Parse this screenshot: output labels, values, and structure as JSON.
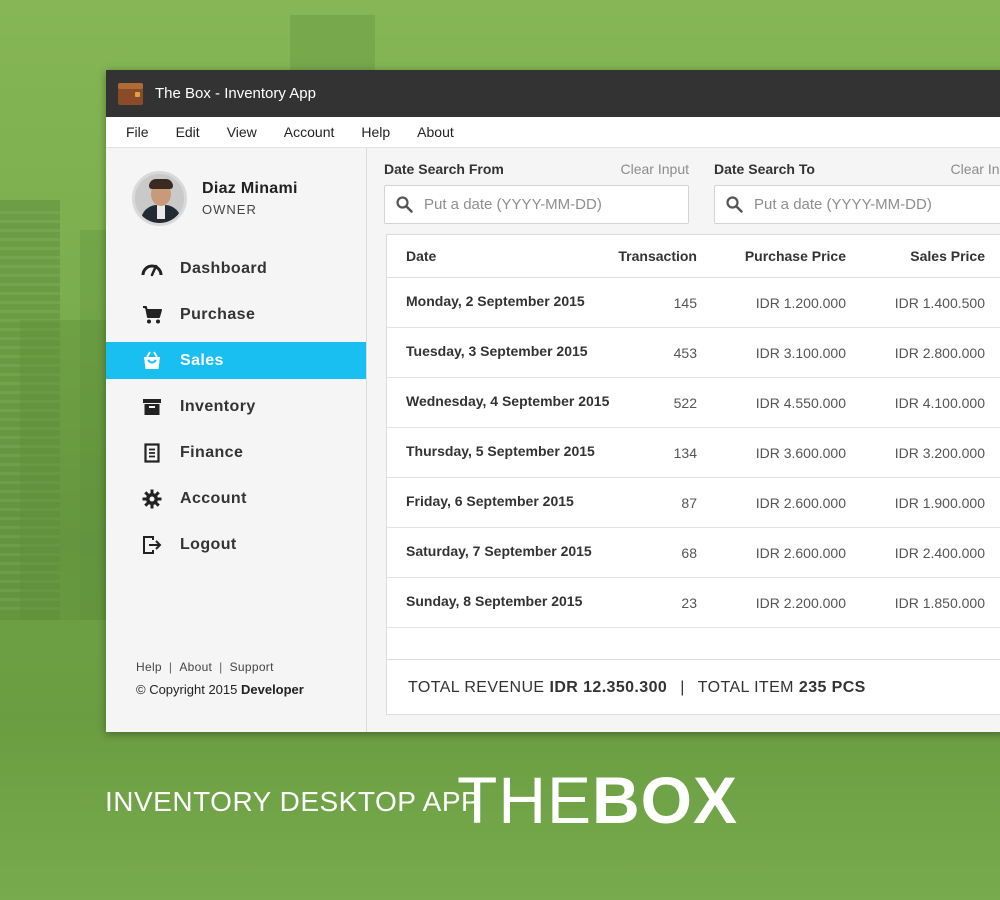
{
  "window": {
    "title": "The Box - Inventory App"
  },
  "menu": [
    {
      "label": "File"
    },
    {
      "label": "Edit"
    },
    {
      "label": "View"
    },
    {
      "label": "Account"
    },
    {
      "label": "Help"
    },
    {
      "label": "About"
    }
  ],
  "profile": {
    "name": "Diaz Minami",
    "role": "OWNER"
  },
  "nav": [
    {
      "label": "Dashboard",
      "icon": "gauge-icon",
      "active": false
    },
    {
      "label": "Purchase",
      "icon": "cart-icon",
      "active": false
    },
    {
      "label": "Sales",
      "icon": "shopping-bag-icon",
      "active": true
    },
    {
      "label": "Inventory",
      "icon": "archive-box-icon",
      "active": false
    },
    {
      "label": "Finance",
      "icon": "document-icon",
      "active": false
    },
    {
      "label": "Account",
      "icon": "gear-icon",
      "active": false
    },
    {
      "label": "Logout",
      "icon": "logout-icon",
      "active": false
    }
  ],
  "footer": {
    "links": [
      "Help",
      "About",
      "Support"
    ],
    "copyright": "© Copyright 2015",
    "developer": "Developer"
  },
  "search_from": {
    "label": "Date Search From",
    "clear": "Clear Input",
    "placeholder": "Put a date (YYYY-MM-DD)"
  },
  "search_to": {
    "label": "Date Search To",
    "clear": "Clear Input",
    "placeholder": "Put a date (YYYY-MM-DD)"
  },
  "table": {
    "headers": [
      "Date",
      "Transaction",
      "Purchase Price",
      "Sales Price"
    ],
    "rows": [
      [
        "Monday, 2 September 2015",
        "145",
        "IDR 1.200.000",
        "IDR 1.400.500"
      ],
      [
        "Tuesday, 3 September 2015",
        "453",
        "IDR 3.100.000",
        "IDR 2.800.000"
      ],
      [
        "Wednesday, 4 September 2015",
        "522",
        "IDR 4.550.000",
        "IDR 4.100.000"
      ],
      [
        "Thursday, 5 September 2015",
        "134",
        "IDR 3.600.000",
        "IDR 3.200.000"
      ],
      [
        "Friday, 6 September 2015",
        "87",
        "IDR 2.600.000",
        "IDR 1.900.000"
      ],
      [
        "Saturday, 7 September 2015",
        "68",
        "IDR 2.600.000",
        "IDR 2.400.000"
      ],
      [
        "Sunday, 8 September 2015",
        "23",
        "IDR 2.200.000",
        "IDR 1.850.000"
      ]
    ]
  },
  "summary": {
    "revenue_label": "TOTAL REVENUE",
    "revenue_value": "IDR 12.350.300",
    "separator": "|",
    "items_label": "TOTAL ITEM",
    "items_value": "235 PCS"
  },
  "branding": {
    "tagline": "INVENTORY DESKTOP APP",
    "brand_light": "THE",
    "brand_bold": "BOX"
  },
  "colors": {
    "active_nav": "#18bff0",
    "titlebar": "#333333",
    "background_green": "#6c9e44"
  }
}
